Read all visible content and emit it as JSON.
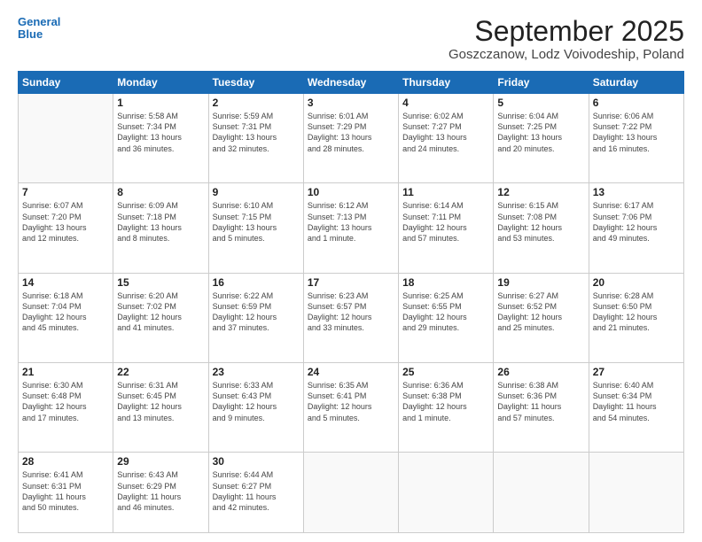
{
  "header": {
    "logo_line1": "General",
    "logo_line2": "Blue",
    "month": "September 2025",
    "location": "Goszczanow, Lodz Voivodeship, Poland"
  },
  "weekdays": [
    "Sunday",
    "Monday",
    "Tuesday",
    "Wednesday",
    "Thursday",
    "Friday",
    "Saturday"
  ],
  "weeks": [
    [
      {
        "day": "",
        "info": ""
      },
      {
        "day": "1",
        "info": "Sunrise: 5:58 AM\nSunset: 7:34 PM\nDaylight: 13 hours\nand 36 minutes."
      },
      {
        "day": "2",
        "info": "Sunrise: 5:59 AM\nSunset: 7:31 PM\nDaylight: 13 hours\nand 32 minutes."
      },
      {
        "day": "3",
        "info": "Sunrise: 6:01 AM\nSunset: 7:29 PM\nDaylight: 13 hours\nand 28 minutes."
      },
      {
        "day": "4",
        "info": "Sunrise: 6:02 AM\nSunset: 7:27 PM\nDaylight: 13 hours\nand 24 minutes."
      },
      {
        "day": "5",
        "info": "Sunrise: 6:04 AM\nSunset: 7:25 PM\nDaylight: 13 hours\nand 20 minutes."
      },
      {
        "day": "6",
        "info": "Sunrise: 6:06 AM\nSunset: 7:22 PM\nDaylight: 13 hours\nand 16 minutes."
      }
    ],
    [
      {
        "day": "7",
        "info": "Sunrise: 6:07 AM\nSunset: 7:20 PM\nDaylight: 13 hours\nand 12 minutes."
      },
      {
        "day": "8",
        "info": "Sunrise: 6:09 AM\nSunset: 7:18 PM\nDaylight: 13 hours\nand 8 minutes."
      },
      {
        "day": "9",
        "info": "Sunrise: 6:10 AM\nSunset: 7:15 PM\nDaylight: 13 hours\nand 5 minutes."
      },
      {
        "day": "10",
        "info": "Sunrise: 6:12 AM\nSunset: 7:13 PM\nDaylight: 13 hours\nand 1 minute."
      },
      {
        "day": "11",
        "info": "Sunrise: 6:14 AM\nSunset: 7:11 PM\nDaylight: 12 hours\nand 57 minutes."
      },
      {
        "day": "12",
        "info": "Sunrise: 6:15 AM\nSunset: 7:08 PM\nDaylight: 12 hours\nand 53 minutes."
      },
      {
        "day": "13",
        "info": "Sunrise: 6:17 AM\nSunset: 7:06 PM\nDaylight: 12 hours\nand 49 minutes."
      }
    ],
    [
      {
        "day": "14",
        "info": "Sunrise: 6:18 AM\nSunset: 7:04 PM\nDaylight: 12 hours\nand 45 minutes."
      },
      {
        "day": "15",
        "info": "Sunrise: 6:20 AM\nSunset: 7:02 PM\nDaylight: 12 hours\nand 41 minutes."
      },
      {
        "day": "16",
        "info": "Sunrise: 6:22 AM\nSunset: 6:59 PM\nDaylight: 12 hours\nand 37 minutes."
      },
      {
        "day": "17",
        "info": "Sunrise: 6:23 AM\nSunset: 6:57 PM\nDaylight: 12 hours\nand 33 minutes."
      },
      {
        "day": "18",
        "info": "Sunrise: 6:25 AM\nSunset: 6:55 PM\nDaylight: 12 hours\nand 29 minutes."
      },
      {
        "day": "19",
        "info": "Sunrise: 6:27 AM\nSunset: 6:52 PM\nDaylight: 12 hours\nand 25 minutes."
      },
      {
        "day": "20",
        "info": "Sunrise: 6:28 AM\nSunset: 6:50 PM\nDaylight: 12 hours\nand 21 minutes."
      }
    ],
    [
      {
        "day": "21",
        "info": "Sunrise: 6:30 AM\nSunset: 6:48 PM\nDaylight: 12 hours\nand 17 minutes."
      },
      {
        "day": "22",
        "info": "Sunrise: 6:31 AM\nSunset: 6:45 PM\nDaylight: 12 hours\nand 13 minutes."
      },
      {
        "day": "23",
        "info": "Sunrise: 6:33 AM\nSunset: 6:43 PM\nDaylight: 12 hours\nand 9 minutes."
      },
      {
        "day": "24",
        "info": "Sunrise: 6:35 AM\nSunset: 6:41 PM\nDaylight: 12 hours\nand 5 minutes."
      },
      {
        "day": "25",
        "info": "Sunrise: 6:36 AM\nSunset: 6:38 PM\nDaylight: 12 hours\nand 1 minute."
      },
      {
        "day": "26",
        "info": "Sunrise: 6:38 AM\nSunset: 6:36 PM\nDaylight: 11 hours\nand 57 minutes."
      },
      {
        "day": "27",
        "info": "Sunrise: 6:40 AM\nSunset: 6:34 PM\nDaylight: 11 hours\nand 54 minutes."
      }
    ],
    [
      {
        "day": "28",
        "info": "Sunrise: 6:41 AM\nSunset: 6:31 PM\nDaylight: 11 hours\nand 50 minutes."
      },
      {
        "day": "29",
        "info": "Sunrise: 6:43 AM\nSunset: 6:29 PM\nDaylight: 11 hours\nand 46 minutes."
      },
      {
        "day": "30",
        "info": "Sunrise: 6:44 AM\nSunset: 6:27 PM\nDaylight: 11 hours\nand 42 minutes."
      },
      {
        "day": "",
        "info": ""
      },
      {
        "day": "",
        "info": ""
      },
      {
        "day": "",
        "info": ""
      },
      {
        "day": "",
        "info": ""
      }
    ]
  ]
}
